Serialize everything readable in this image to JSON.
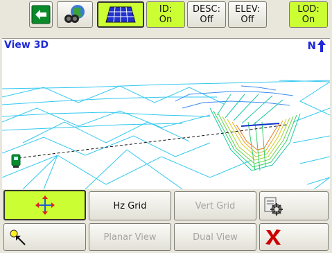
{
  "toolbar": {
    "back_icon": "left-arrow-icon",
    "binoculars_icon": "binoculars-globe-icon",
    "grid_icon": "grid-plane-icon",
    "toggles": [
      {
        "label": "ID:",
        "value": "On",
        "active": true
      },
      {
        "label": "DESC:",
        "value": "Off",
        "active": false
      },
      {
        "label": "ELEV:",
        "value": "Off",
        "active": false
      },
      {
        "label": "LOD:",
        "value": "On",
        "active": true
      }
    ]
  },
  "view": {
    "title": "View 3D",
    "north_label": "N"
  },
  "buttons": {
    "pan_icon": "pan-cross-arrows-icon",
    "hz_grid": "Hz Grid",
    "vert_grid": "Vert Grid",
    "settings_icon": "settings-gear-icon",
    "zoom_icon": "zoom-pointer-icon",
    "planar_view": "Planar View",
    "dual_view": "Dual View",
    "close_icon": "red-x-close-icon"
  },
  "colors": {
    "active_green": "#ccff33",
    "title_blue": "#1f2ad6",
    "close_red": "#cc0000"
  }
}
